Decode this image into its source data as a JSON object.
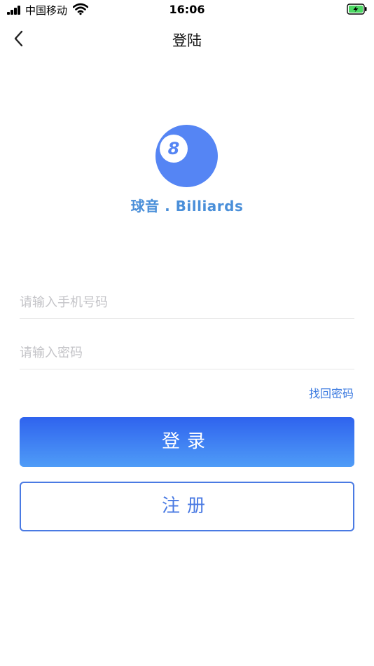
{
  "status_bar": {
    "carrier": "中国移动",
    "time": "16:06"
  },
  "nav": {
    "title": "登陆"
  },
  "logo": {
    "ball_number": "8",
    "brand_text": "球音 . Billiards"
  },
  "form": {
    "phone_placeholder": "请输入手机号码",
    "phone_value": "",
    "password_placeholder": "请输入密码",
    "password_value": "",
    "forgot_label": "找回密码"
  },
  "buttons": {
    "login_label": "登录",
    "register_label": "注册"
  },
  "colors": {
    "accent": "#3d7be0",
    "logo": "#5585f4",
    "login_gradient_top": "#2f63ee",
    "login_gradient_bottom": "#4f9cf7",
    "battery": "#4cd964"
  },
  "icons": [
    "signal-icon",
    "wifi-icon",
    "battery-charging-icon",
    "back-chevron-icon"
  ]
}
